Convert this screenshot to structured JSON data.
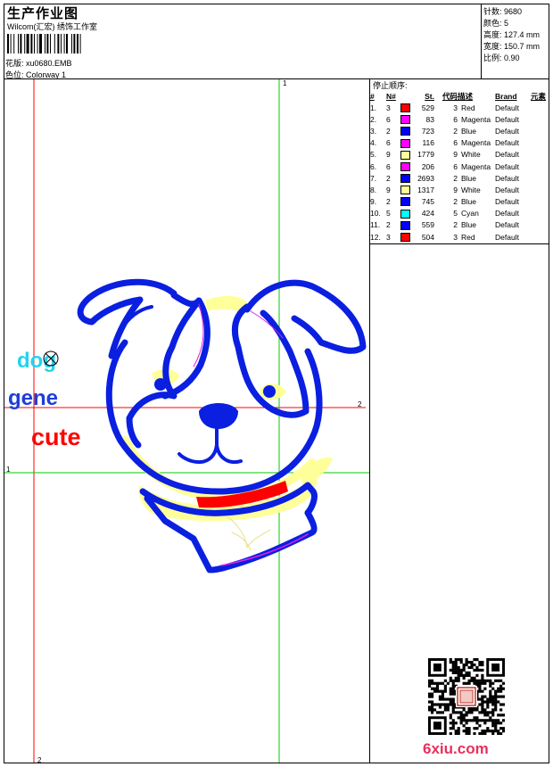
{
  "header": {
    "title": "生产作业图",
    "company": "Wilcom(汇宏) 绣饰工作室",
    "design_label": "花版: xu0680.EMB",
    "colorway_label": "色位: Colorway 1"
  },
  "stats": [
    {
      "label": "针数:",
      "value": "9680"
    },
    {
      "label": "颜色:",
      "value": "5"
    },
    {
      "label": "高度:",
      "value": "127.4 mm"
    },
    {
      "label": "宽度:",
      "value": "150.7 mm"
    },
    {
      "label": "比例:",
      "value": "0.90"
    }
  ],
  "stop_sequence": {
    "title": "停止顺序:",
    "columns": [
      "#",
      "N#",
      "St.",
      "代码",
      "描述",
      "Brand",
      "元素"
    ],
    "rows": [
      {
        "idx": "1.",
        "n": "3",
        "color": "#ff0000",
        "st": "529",
        "code": "3",
        "desc": "Red",
        "brand": "Default"
      },
      {
        "idx": "2.",
        "n": "6",
        "color": "#ff00ff",
        "st": "83",
        "code": "6",
        "desc": "Magenta",
        "brand": "Default"
      },
      {
        "idx": "3.",
        "n": "2",
        "color": "#0000ff",
        "st": "723",
        "code": "2",
        "desc": "Blue",
        "brand": "Default"
      },
      {
        "idx": "4.",
        "n": "6",
        "color": "#ff00ff",
        "st": "116",
        "code": "6",
        "desc": "Magenta",
        "brand": "Default"
      },
      {
        "idx": "5.",
        "n": "9",
        "color": "#ffff99",
        "st": "1779",
        "code": "9",
        "desc": "White",
        "brand": "Default"
      },
      {
        "idx": "6.",
        "n": "6",
        "color": "#ff00ff",
        "st": "206",
        "code": "6",
        "desc": "Magenta",
        "brand": "Default"
      },
      {
        "idx": "7.",
        "n": "2",
        "color": "#0000ff",
        "st": "2693",
        "code": "2",
        "desc": "Blue",
        "brand": "Default"
      },
      {
        "idx": "8.",
        "n": "9",
        "color": "#ffff99",
        "st": "1317",
        "code": "9",
        "desc": "White",
        "brand": "Default"
      },
      {
        "idx": "9.",
        "n": "2",
        "color": "#0000ff",
        "st": "745",
        "code": "2",
        "desc": "Blue",
        "brand": "Default"
      },
      {
        "idx": "10.",
        "n": "5",
        "color": "#00ffff",
        "st": "424",
        "code": "5",
        "desc": "Cyan",
        "brand": "Default"
      },
      {
        "idx": "11.",
        "n": "2",
        "color": "#0000ff",
        "st": "559",
        "code": "2",
        "desc": "Blue",
        "brand": "Default"
      },
      {
        "idx": "12.",
        "n": "3",
        "color": "#ff0000",
        "st": "504",
        "code": "3",
        "desc": "Red",
        "brand": "Default"
      }
    ]
  },
  "design": {
    "words": [
      "dog",
      "gene",
      "cute"
    ],
    "word_colors": [
      "#22d3ee",
      "#1e3fd8",
      "#ff0000"
    ],
    "guide_labels": {
      "vertical_green": "1",
      "horizontal_green": "1",
      "vertical_red": "2",
      "horizontal_red": "2"
    },
    "colors": {
      "blue": "#0a1fe0",
      "yellow": "#ffff99",
      "red": "#ff0000",
      "magenta": "#e020e0",
      "cyan": "#22d3ee",
      "guide_red": "#ff0000",
      "guide_green": "#00cc00"
    }
  },
  "watermark": "6xiu.com"
}
